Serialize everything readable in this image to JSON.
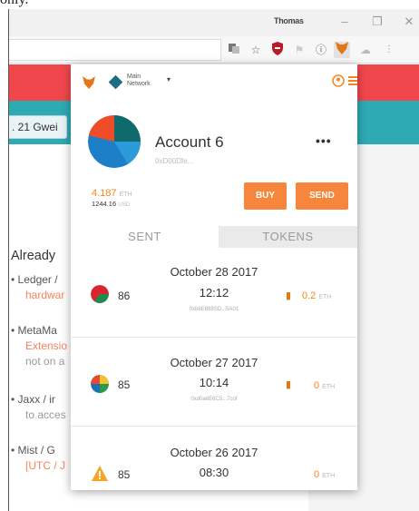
{
  "browser": {
    "top_cut_text": "only.",
    "profile_name": "Thomas",
    "window_buttons": [
      "–",
      "❐",
      "✕"
    ],
    "toolbar_icons": [
      "translate-icon",
      "star-icon",
      "shield-icon",
      "flag-icon",
      "info-icon",
      "metamask-fox-icon",
      "extension-icon",
      "menu-icon"
    ]
  },
  "page": {
    "gas_price": ". 21 Gwei",
    "already_heading": "Already",
    "bullets": [
      {
        "title": "Ledger /",
        "sub": "hardwar",
        "sub_color": "orange"
      },
      {
        "title": "MetaMa",
        "sub": "Extensio",
        "sub2": "not on a",
        "sub_color": "orange"
      },
      {
        "title": "Jaxx / ir",
        "sub": "to acces",
        "sub_color": "grey"
      },
      {
        "title": "Mist / G",
        "sub": "[UTC / J",
        "sub_color": "orange"
      }
    ]
  },
  "metamask": {
    "network_label": "Main Network",
    "network_caret": "▾",
    "header_icons_text": "⌂≡",
    "account": {
      "name": "Account 6",
      "address": "0xD00Dfe...",
      "menu_dots": "•••",
      "eth_balance": "4.187",
      "eth_unit": "ETH",
      "usd_balance": "1244.16",
      "usd_unit": "USD"
    },
    "buttons": {
      "buy": "BUY",
      "send": "SEND"
    },
    "tabs": {
      "sent": "SENT",
      "tokens": "TOKENS"
    },
    "transactions": [
      {
        "nonce": "86",
        "date": "October 28 2017",
        "time": "12:12",
        "hash": "0xb8E888SD...5A01",
        "amount": "0.2",
        "unit": "ETH",
        "icon": "identicon-red-green",
        "status_icon": "document-icon"
      },
      {
        "nonce": "85",
        "date": "October 27 2017",
        "time": "10:14",
        "hash": "0xd0a6E6C5...7cof",
        "amount": "0",
        "unit": "ETH",
        "icon": "identicon-multicolor",
        "status_icon": "document-icon"
      },
      {
        "nonce": "85",
        "date": "October 26 2017",
        "time": "08:30",
        "hash": "",
        "amount": "0",
        "unit": "ETH",
        "icon": "warning-icon",
        "status_icon": ""
      }
    ]
  }
}
